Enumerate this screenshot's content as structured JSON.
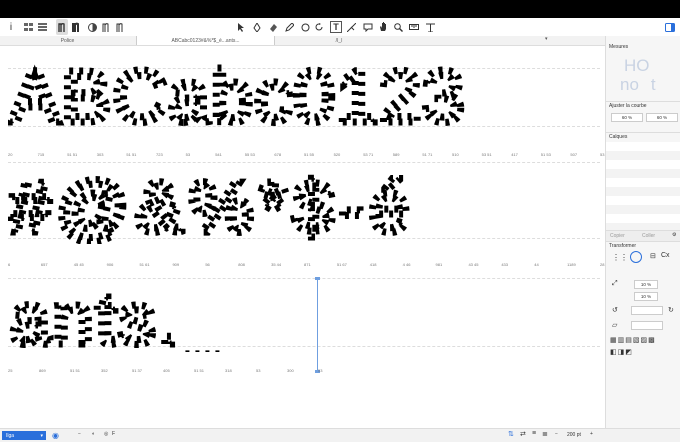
{
  "toolbar": {
    "left_tools": [
      "info-icon",
      "grid-view-icon",
      "list-view-icon",
      "glyph-n-icon",
      "glyph-n-bold-icon",
      "compare-icon",
      "glyph-n-outline-icon",
      "glyph-n-double-icon"
    ],
    "center_tools": [
      "pointer-icon",
      "pen-icon",
      "eraser-icon",
      "pencil-icon",
      "circle-icon",
      "rotate-icon",
      "text-tool-icon",
      "knife-icon",
      "bubble-icon",
      "hand-icon",
      "zoom-icon",
      "ruler-icon",
      "measure-icon"
    ],
    "text_tool_label": "T"
  },
  "tabs": [
    {
      "label": "Police"
    },
    {
      "label": "ABCabc0123#&%*$_é...ants..."
    },
    {
      "label": "/I_l"
    }
  ],
  "glyph_rows": [
    {
      "text": "ABCabc0123",
      "numbers": [
        "20",
        "715",
        "51 51",
        "303",
        "51 51",
        "723",
        "53",
        "541",
        "55 53",
        "678",
        "51 55",
        "520",
        "53 71",
        "589",
        "51 71",
        "510",
        "53 51",
        "417",
        "51 53",
        "507",
        "53"
      ]
    },
    {
      "text": "#@&%*$-é",
      "numbers": [
        "6",
        "657",
        "45 45",
        "906",
        "51 61",
        "909",
        "56",
        "808",
        "35 44",
        "871",
        "51 67",
        "418",
        "4 46",
        "981",
        "43 45",
        "433",
        "44",
        "1189",
        "28"
      ]
    },
    {
      "text": "ants._",
      "numbers": [
        "25",
        "869",
        "51 51",
        "352",
        "51 37",
        "405",
        "51 51",
        "318",
        "53",
        "300",
        "53"
      ]
    }
  ],
  "sidebar": {
    "mesures_title": "Mesures",
    "preview_glyphs": [
      "HO",
      "no",
      "t"
    ],
    "courbe_title": "Ajuster la courbe",
    "courbe_values": [
      "60 %",
      "60 %"
    ],
    "calques_title": "Calques",
    "copier_label": "Copier",
    "coller_label": "Coller",
    "transformer_title": "Transformer",
    "scale_value_1": "10 %",
    "scale_value_2": "10 %"
  },
  "bottombar": {
    "layer_select": "Ilga",
    "zoom_label": "200 pt",
    "fg_label": "F"
  }
}
